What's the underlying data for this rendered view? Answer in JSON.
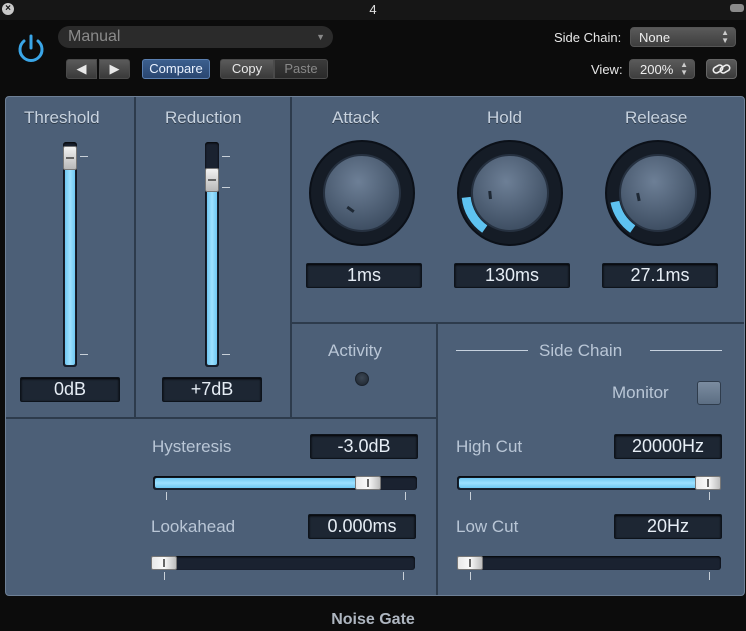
{
  "window": {
    "title": "4"
  },
  "header": {
    "preset_name": "Manual",
    "nav_prev": "◀",
    "nav_next": "▶",
    "compare_label": "Compare",
    "copy_label": "Copy",
    "paste_label": "Paste",
    "side_chain_label": "Side Chain:",
    "side_chain_value": "None",
    "view_label": "View:",
    "view_value": "200%",
    "power_icon": "power-icon",
    "link_icon": "link-icon",
    "accent_color": "#3aa6e8"
  },
  "plugin": {
    "threshold": {
      "label": "Threshold",
      "value": "0dB",
      "level": 0.98
    },
    "reduction": {
      "label": "Reduction",
      "value": "+7dB",
      "level": 0.87
    },
    "attack": {
      "label": "Attack",
      "value": "1ms",
      "fraction": 0.0
    },
    "hold": {
      "label": "Hold",
      "value": "130ms",
      "fraction": 0.17
    },
    "release": {
      "label": "Release",
      "value": "27.1ms",
      "fraction": 0.15
    },
    "activity": {
      "label": "Activity"
    },
    "side_chain": {
      "title": "Side Chain",
      "monitor_label": "Monitor",
      "high_cut": {
        "label": "High Cut",
        "value": "20000Hz",
        "fraction": 1.0
      },
      "low_cut": {
        "label": "Low Cut",
        "value": "20Hz",
        "fraction": 0.0
      }
    },
    "hysteresis": {
      "label": "Hysteresis",
      "value": "-3.0dB",
      "fraction": 0.85
    },
    "lookahead": {
      "label": "Lookahead",
      "value": "0.000ms",
      "fraction": 0.0
    }
  },
  "footer": {
    "plugin_name": "Noise Gate"
  },
  "colors": {
    "panel": "#4c5f77",
    "slider_fill": "#7fd1f7",
    "knob_arc": "#5ec2f0"
  }
}
